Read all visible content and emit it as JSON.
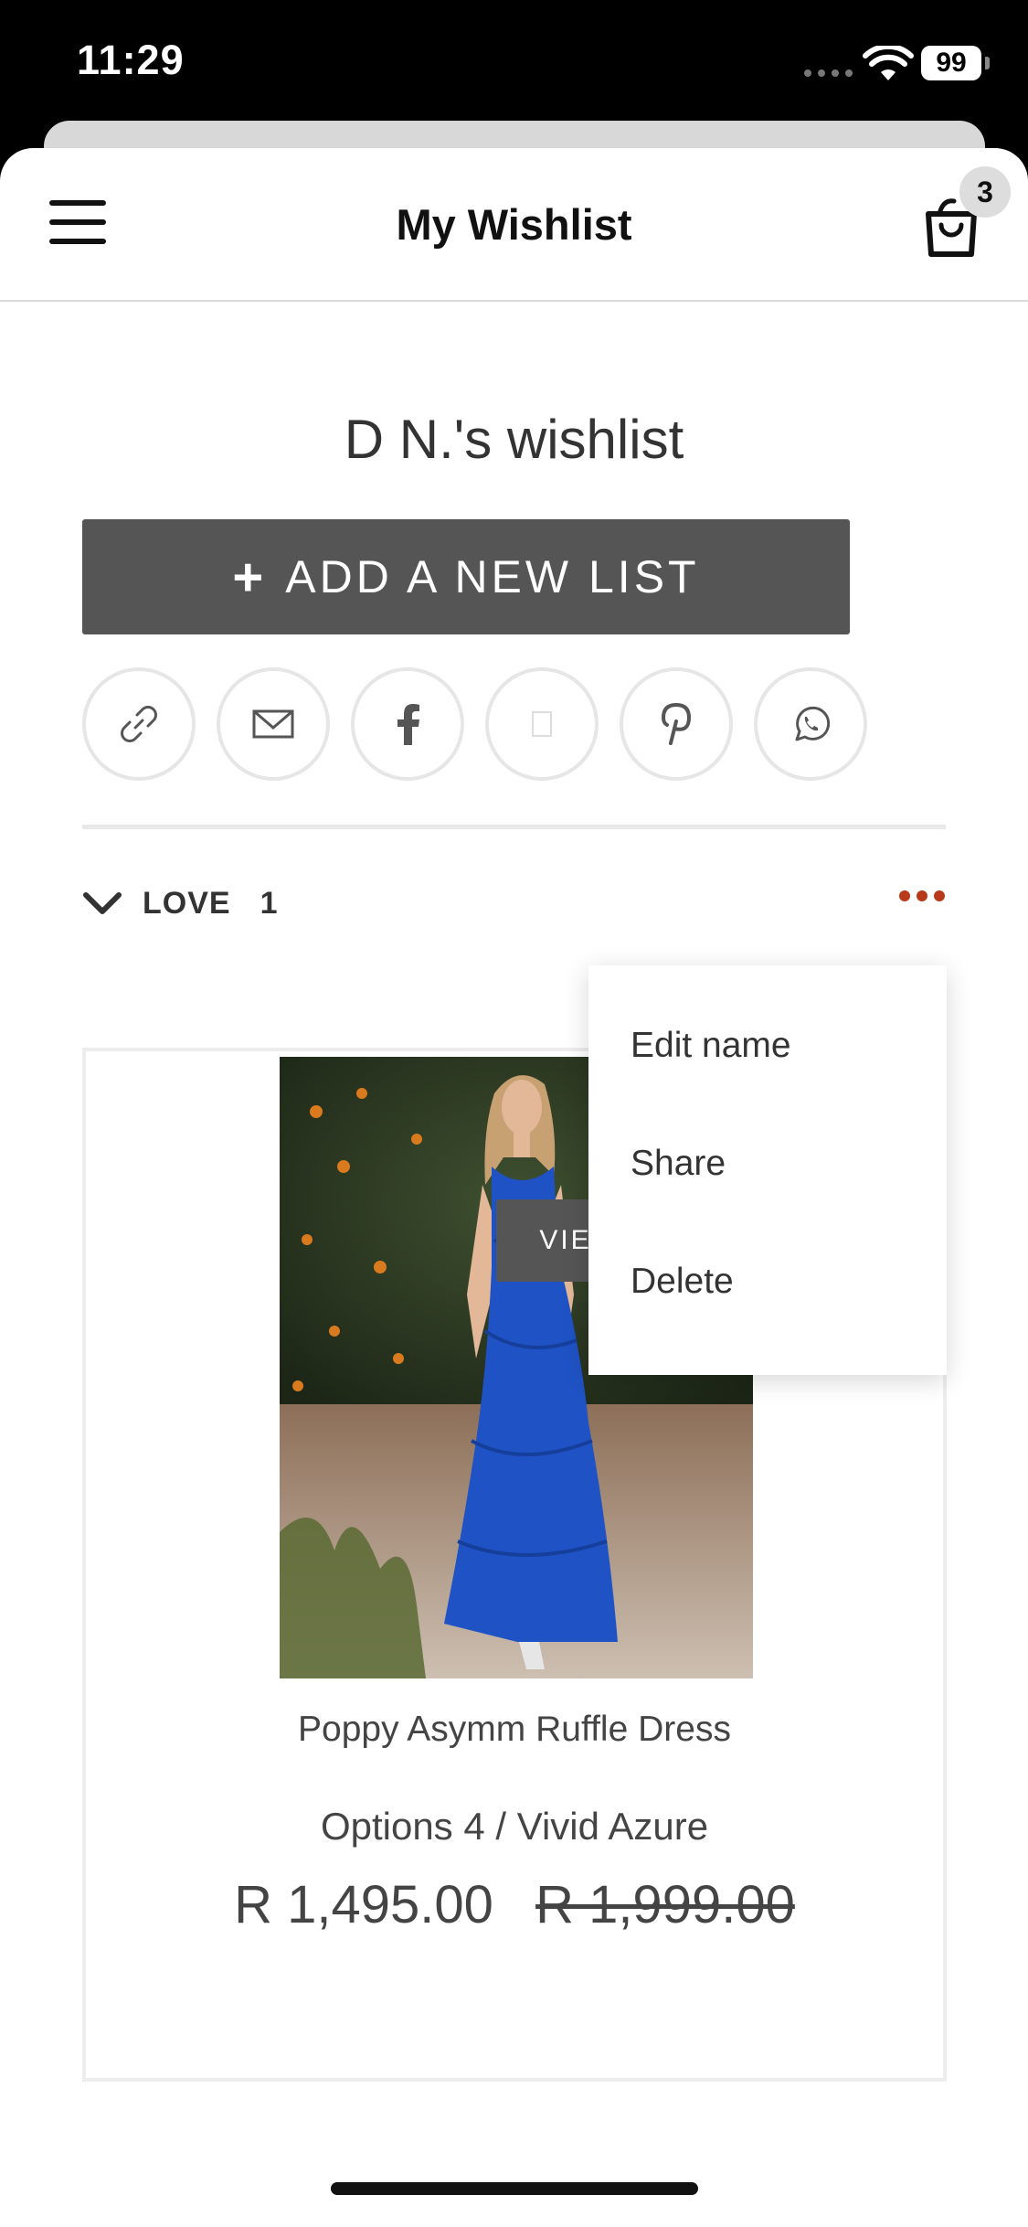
{
  "status_bar": {
    "time": "11:29",
    "battery": "99"
  },
  "header": {
    "title": "My Wishlist",
    "cart_count": "3"
  },
  "wishlist": {
    "title": "D N.'s wishlist",
    "add_list_label": "ADD A NEW LIST",
    "share_buttons": [
      "link-icon",
      "email-icon",
      "facebook-icon",
      "twitter-icon",
      "pinterest-icon",
      "whatsapp-icon"
    ]
  },
  "list": {
    "name": "LOVE",
    "count": "1"
  },
  "context_menu": {
    "items": [
      "Edit name",
      "Share",
      "Delete"
    ]
  },
  "product": {
    "name": "Poppy Asymm Ruffle Dress",
    "options": "Options 4 / Vivid Azure",
    "price_sale": "R 1,495.00",
    "price_original": "R 1,999.00",
    "view_label": "VIEW PRODUCT"
  },
  "colors": {
    "button_gray": "#555555",
    "accent_dots": "#b83a1b",
    "dress_blue": "#1f52c4"
  }
}
